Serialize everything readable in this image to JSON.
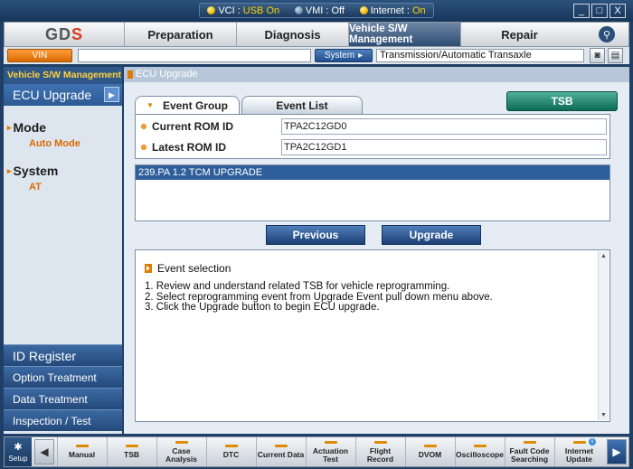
{
  "status_bar": {
    "vci_label": "VCI :",
    "vci_value": "USB On",
    "vmi_label": "VMI :",
    "vmi_value": "Off",
    "internet_label": "Internet :",
    "internet_value": "On",
    "window_controls": [
      "_",
      "□",
      "X"
    ]
  },
  "menu": {
    "logo_main": "GD",
    "logo_accent": "S",
    "tabs": [
      "Preparation",
      "Diagnosis",
      "Vehicle S/W Management",
      "Repair"
    ],
    "active_tab": "Vehicle S/W Management",
    "search_icon": "magnifier-icon"
  },
  "vin_row": {
    "vin_label": "VIN",
    "vin_value": "",
    "system_label": "System",
    "system_value": "Transmission/Automatic Transaxle"
  },
  "left_panel": {
    "title": "Vehicle S/W Management",
    "active_item": "ECU Upgrade",
    "sections": [
      {
        "heading": "Mode",
        "value": "Auto Mode"
      },
      {
        "heading": "System",
        "value": "AT"
      }
    ],
    "bottom_buttons": [
      "ID Register",
      "Option Treatment",
      "Data Treatment",
      "Inspection / Test"
    ]
  },
  "content": {
    "breadcrumb": "ECU Upgrade",
    "tabs": [
      "Event Group",
      "Event List"
    ],
    "active_tab": "Event Group",
    "tsb_button": "TSB",
    "current_rom_label": "Current ROM ID",
    "current_rom_value": "TPA2C12GD0",
    "latest_rom_label": "Latest ROM ID",
    "latest_rom_value": "TPA2C12GD1",
    "event_items": [
      "239.PA 1.2 TCM UPGRADE"
    ],
    "previous_button": "Previous",
    "upgrade_button": "Upgrade",
    "info_title": "Event selection",
    "info_lines": [
      "1. Review and understand related TSB for vehicle reprogramming.",
      "2. Select reprogramming event from Upgrade Event pull down menu above.",
      "3. Click the Upgrade button to begin ECU upgrade."
    ]
  },
  "toolbar": {
    "setup_label": "Setup",
    "tools": [
      "Manual",
      "TSB",
      "Case Analysis",
      "DTC",
      "Current Data",
      "Actuation Test",
      "Flight Record",
      "DVOM",
      "Oscilloscope",
      "Fault Code Searching",
      "Internet Update"
    ]
  },
  "colors": {
    "accent_orange": "#e07a00",
    "active_blue": "#2e5f9b",
    "tsb_green": "#0c6b55",
    "status_on": "#ffd400"
  }
}
